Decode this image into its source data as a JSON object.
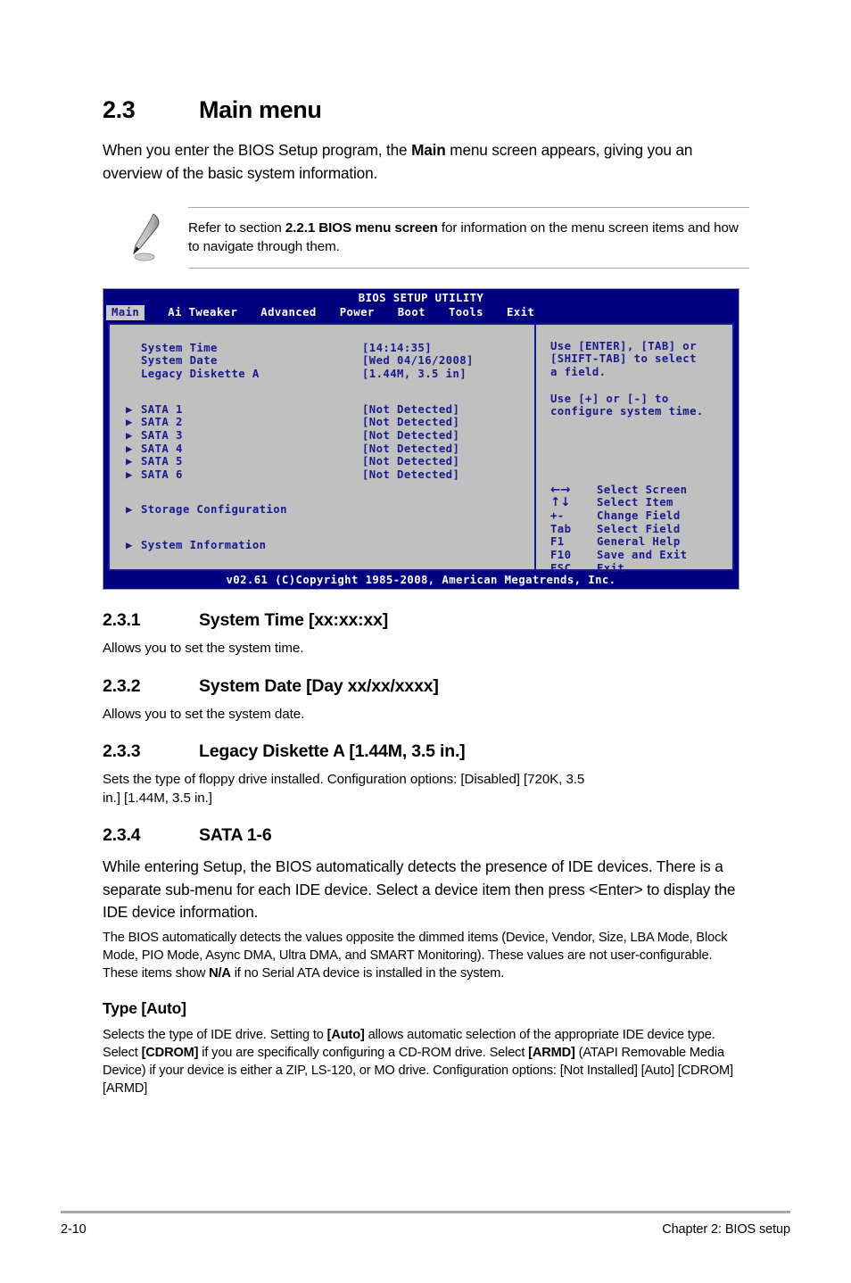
{
  "section": {
    "number": "2.3",
    "title": "Main menu",
    "intro_a": "When you enter the BIOS Setup program, the ",
    "intro_bold": "Main",
    "intro_b": " menu screen appears, giving you an overview of the basic system information."
  },
  "note": {
    "icon": "pencil-icon",
    "text_a": "Refer to section ",
    "text_bold": "2.2.1 BIOS menu screen",
    "text_b": " for information on the menu screen items and how to navigate through them."
  },
  "bios": {
    "title": "BIOS SETUP UTILITY",
    "tabs": [
      {
        "label": "Main",
        "active": true
      },
      {
        "label": "Ai Tweaker",
        "active": false
      },
      {
        "label": "Advanced",
        "active": false
      },
      {
        "label": "Power",
        "active": false
      },
      {
        "label": "Boot",
        "active": false
      },
      {
        "label": "Tools",
        "active": false
      },
      {
        "label": "Exit",
        "active": false
      }
    ],
    "fields": [
      {
        "label": "System Time",
        "value": "[14:14:35]"
      },
      {
        "label": "System Date",
        "value": "[Wed 04/16/2008]"
      },
      {
        "label": "Legacy Diskette A",
        "value": "[1.44M, 3.5 in]"
      }
    ],
    "sata": [
      {
        "arrow": "▶",
        "label": "SATA 1",
        "value": "[Not Detected]"
      },
      {
        "arrow": "▶",
        "label": "SATA 2",
        "value": "[Not Detected]"
      },
      {
        "arrow": "▶",
        "label": "SATA 3",
        "value": "[Not Detected]"
      },
      {
        "arrow": "▶",
        "label": "SATA 4",
        "value": "[Not Detected]"
      },
      {
        "arrow": "▶",
        "label": "SATA 5",
        "value": "[Not Detected]"
      },
      {
        "arrow": "▶",
        "label": "SATA 6",
        "value": "[Not Detected]"
      }
    ],
    "submenus": [
      {
        "arrow": "▶",
        "label": "Storage Configuration"
      },
      {
        "arrow": "▶",
        "label": "System Information"
      }
    ],
    "help": [
      "Use [ENTER], [TAB] or\n[SHIFT-TAB] to select\na field.",
      "Use [+] or [-] to\nconfigure system time."
    ],
    "legend": [
      {
        "key": "←→",
        "glyph": true,
        "action": "Select Screen"
      },
      {
        "key": "↑↓",
        "glyph": true,
        "action": "Select Item"
      },
      {
        "key": "+-",
        "glyph": false,
        "action": "Change Field"
      },
      {
        "key": "Tab",
        "glyph": false,
        "action": "Select Field"
      },
      {
        "key": "F1",
        "glyph": false,
        "action": "General Help"
      },
      {
        "key": "F10",
        "glyph": false,
        "action": "Save and Exit"
      },
      {
        "key": "ESC",
        "glyph": false,
        "action": "Exit"
      }
    ],
    "footer": "v02.61 (C)Copyright 1985-2008, American Megatrends, Inc.",
    "colors": {
      "header_bg": "#000080",
      "panel_bg": "#c0c0c0",
      "panel_text": "#1a1a8c",
      "active_tab_bg": "#c8c8c8"
    }
  },
  "subsections": {
    "s231": {
      "number": "2.3.1",
      "title": "System Time [xx:xx:xx]",
      "body": "Allows you to set the system time."
    },
    "s232": {
      "number": "2.3.2",
      "title": "System Date [Day xx/xx/xxxx]",
      "body": "Allows you to set the system date."
    },
    "s233": {
      "number": "2.3.3",
      "title": "Legacy Diskette A [1.44M, 3.5 in.]",
      "body": "Sets the type of floppy drive installed. Configuration options: [Disabled] [720K, 3.5 in.] [1.44M, 3.5 in.]"
    },
    "s234": {
      "number": "2.3.4",
      "title": "SATA 1-6",
      "para1": "While entering Setup, the BIOS automatically detects the presence of IDE devices. There is a separate sub-menu for each IDE device. Select a device item then press <Enter> to display the IDE device information.",
      "para2_a": "The BIOS automatically detects the values opposite the dimmed items (Device, Vendor, Size, LBA Mode, Block Mode, PIO Mode, Async DMA, Ultra DMA, and SMART Monitoring). These values are not user-configurable. These items show ",
      "para2_bold": "N/A",
      "para2_b": " if no Serial ATA device is installed in the system."
    },
    "type_auto": {
      "title": "Type [Auto]",
      "p_a": "Selects the type of IDE drive. Setting to ",
      "p_b1": "[Auto]",
      "p_c": " allows automatic selection of the appropriate IDE device type. Select ",
      "p_b2": "[CDROM]",
      "p_d": " if you are specifically configuring a CD-ROM drive. Select ",
      "p_b3": "[ARMD]",
      "p_e": " (ATAPI Removable Media Device) if your device is either a ZIP, LS-120, or MO drive. Configuration options: [Not Installed] [Auto] [CDROM] [ARMD]"
    }
  },
  "footer": {
    "page_number": "2-10",
    "chapter": "Chapter 2: BIOS setup"
  }
}
